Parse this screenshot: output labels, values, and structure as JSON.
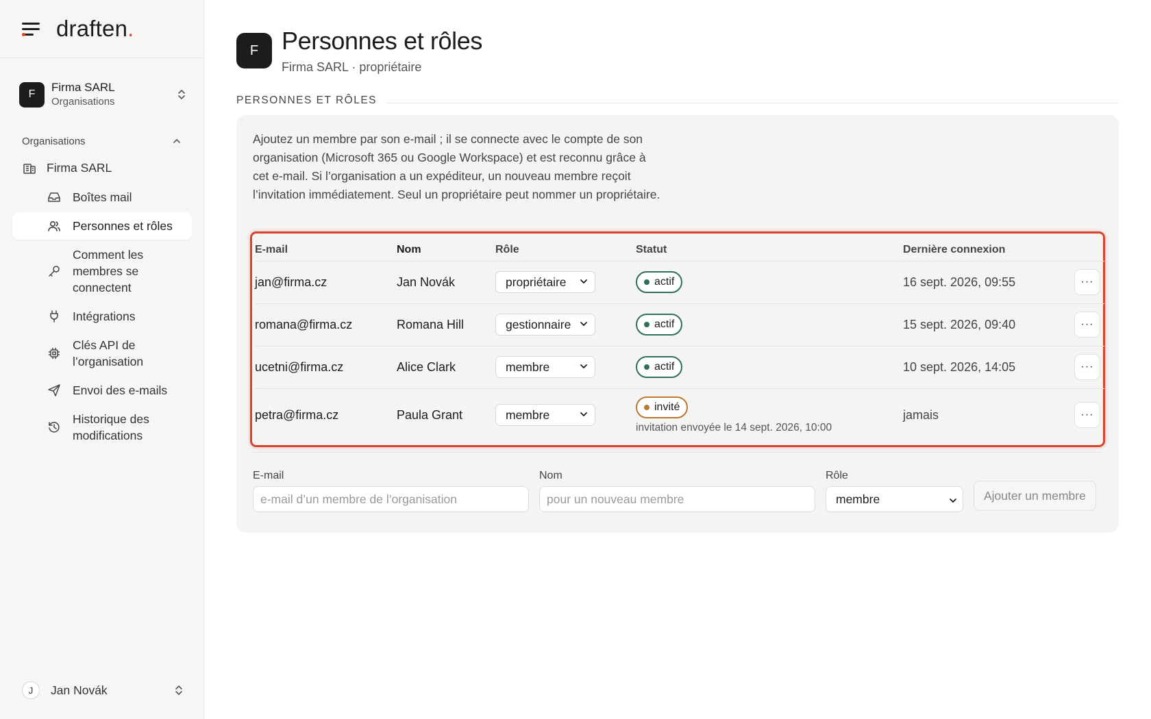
{
  "brand": {
    "logo_text": "draften",
    "logo_dot": "."
  },
  "org_switcher": {
    "avatar": "F",
    "name": "Firma SARL",
    "sub": "Organisations"
  },
  "sidebar": {
    "section_title": "Organisations",
    "org_item": "Firma SARL",
    "items": [
      {
        "label": "Boîtes mail",
        "icon": "inbox-icon"
      },
      {
        "label": "Personnes et rôles",
        "icon": "users-icon",
        "active": true
      },
      {
        "label": "Comment les membres se connectent",
        "icon": "key-icon"
      },
      {
        "label": "Intégrations",
        "icon": "plug-icon"
      },
      {
        "label": "Clés API de l’organisation",
        "icon": "chip-icon"
      },
      {
        "label": "Envoi des e-mails",
        "icon": "send-icon"
      },
      {
        "label": "Historique des modifications",
        "icon": "history-icon"
      }
    ],
    "user": {
      "avatar": "J",
      "name": "Jan Novák"
    }
  },
  "page": {
    "avatar": "F",
    "title": "Personnes et rôles",
    "subtitle": "Firma SARL · propriétaire",
    "section_label": "PERSONNES ET RÔLES",
    "description": "Ajoutez un membre par son e-mail ; il se connecte avec le compte de son organisation (Microsoft 365 ou Google Workspace) et est reconnu grâce à cet e-mail. Si l’organisation a un expéditeur, un nouveau membre reçoit l’invitation immédiatement. Seul un propriétaire peut nommer un propriétaire."
  },
  "table": {
    "headers": {
      "email": "E-mail",
      "nom": "Nom",
      "role": "Rôle",
      "statut": "Statut",
      "last": "Dernière connexion"
    },
    "rows": [
      {
        "email": "jan@firma.cz",
        "nom": "Jan Novák",
        "role": "propriétaire",
        "statut": "actif",
        "last": "16 sept. 2026, 09:55",
        "note": ""
      },
      {
        "email": "romana@firma.cz",
        "nom": "Romana Hill",
        "role": "gestionnaire",
        "statut": "actif",
        "last": "15 sept. 2026, 09:40",
        "note": ""
      },
      {
        "email": "ucetni@firma.cz",
        "nom": "Alice Clark",
        "role": "membre",
        "statut": "actif",
        "last": "10 sept. 2026, 14:05",
        "note": ""
      },
      {
        "email": "petra@firma.cz",
        "nom": "Paula Grant",
        "role": "membre",
        "statut": "invité",
        "last": "jamais",
        "note": "invitation envoyée le 14 sept. 2026, 10:00"
      }
    ],
    "more_label": "···"
  },
  "add_form": {
    "email_label": "E-mail",
    "email_placeholder": "e-mail d’un membre de l’organisation",
    "nom_label": "Nom",
    "nom_placeholder": "pour un nouveau membre",
    "role_label": "Rôle",
    "role_value": "membre",
    "submit": "Ajouter un membre"
  },
  "colors": {
    "accent": "#e0452e",
    "active_status": "#2f6e58",
    "invited_status": "#b97831",
    "highlight": "#d8432e"
  }
}
